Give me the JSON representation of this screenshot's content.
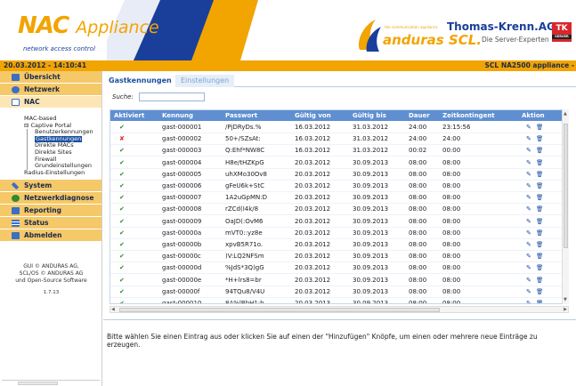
{
  "header": {
    "product_name": "NAC",
    "product_suffix": "Appliance",
    "product_tagline": "network access control",
    "partner_small": "the communication appliance",
    "partner_name": "anduras SCL.",
    "company_name": "Thomas-Krenn.AG",
    "company_tagline": "Die Server-Experten",
    "company_logo": "TK",
    "company_logo_sub": "SERVER"
  },
  "statusbar": {
    "datetime": "20.03.2012 - 14:10:41",
    "appliance": "SCL NA2500 appliance -"
  },
  "sidebar": {
    "items_top": [
      {
        "label": "Übersicht",
        "icon": "overview-icon",
        "color": "#3a6fc4"
      },
      {
        "label": "Netzwerk",
        "icon": "network-icon",
        "color": "#3a6fc4"
      },
      {
        "label": "NAC",
        "icon": "nac-icon",
        "color": "#3a6fc4"
      }
    ],
    "tree": {
      "mac_based": "MAC-based",
      "captive_portal": "Captive Portal",
      "benutzerkennungen": "Benutzerkennungen",
      "gastkennungen": "Gastkennungen",
      "direkte_macs": "Direkte MACs",
      "direkte_sites": "Direkte Sites",
      "firewall": "Firewall",
      "grundeinstellungen": "Grundeinstellungen",
      "radius": "Radius-Einstellungen"
    },
    "items_bottom": [
      {
        "label": "System",
        "icon": "wrench-icon",
        "color": "#3a6fc4"
      },
      {
        "label": "Netzwerkdiagnose",
        "icon": "diagnostics-icon",
        "color": "#2e8b2e"
      },
      {
        "label": "Reporting",
        "icon": "reporting-icon",
        "color": "#3a6fc4"
      },
      {
        "label": "Status",
        "icon": "status-icon",
        "color": "#3a6fc4"
      },
      {
        "label": "Abmelden",
        "icon": "logout-icon",
        "color": "#3a6fc4"
      }
    ],
    "footer_line1": "GUI © ANDURAS AG,",
    "footer_line2": "SCL/OS © ANDURAS AG",
    "footer_line3": "und Open-Source Software",
    "version": "1.7.13"
  },
  "tabs": {
    "active": "Gastkennungen",
    "inactive": "Einstellungen"
  },
  "search": {
    "label": "Suche:",
    "value": "",
    "placeholder": ""
  },
  "table": {
    "columns": [
      "Aktiviert",
      "Kennung",
      "Passwort",
      "Gültig von",
      "Gültig bis",
      "Dauer",
      "Zeitkontingent",
      "Aktion"
    ],
    "rows": [
      {
        "active": true,
        "id": "gast-000001",
        "pw": "/PjDRyDs.%",
        "from": "16.03.2012",
        "to": "31.03.2012",
        "dur": "24:00",
        "quota": "23:15:56"
      },
      {
        "active": false,
        "id": "gast-000002",
        "pw": "50+/SZsAt:",
        "from": "16.03.2012",
        "to": "31.03.2012",
        "dur": "24:00",
        "quota": "24:00"
      },
      {
        "active": true,
        "id": "gast-000003",
        "pw": "Q:Ehf*NW8C",
        "from": "16.03.2012",
        "to": "31.03.2012",
        "dur": "00:02",
        "quota": "00:00"
      },
      {
        "active": true,
        "id": "gast-000004",
        "pw": "H8e/tHZKpG",
        "from": "20.03.2012",
        "to": "30.09.2013",
        "dur": "08:00",
        "quota": "08:00"
      },
      {
        "active": true,
        "id": "gast-000005",
        "pw": "uhXMo30Ov8",
        "from": "20.03.2012",
        "to": "30.09.2013",
        "dur": "08:00",
        "quota": "08:00"
      },
      {
        "active": true,
        "id": "gast-000006",
        "pw": "gFeU6k+StC",
        "from": "20.03.2012",
        "to": "30.09.2013",
        "dur": "08:00",
        "quota": "08:00"
      },
      {
        "active": true,
        "id": "gast-000007",
        "pw": "1A2uGpMN:D",
        "from": "20.03.2012",
        "to": "30.09.2013",
        "dur": "08:00",
        "quota": "08:00"
      },
      {
        "active": true,
        "id": "gast-000008",
        "pw": "rZCd(I4k/8",
        "from": "20.03.2012",
        "to": "30.09.2013",
        "dur": "08:00",
        "quota": "08:00"
      },
      {
        "active": true,
        "id": "gast-000009",
        "pw": "OaJD(:OvM6",
        "from": "20.03.2012",
        "to": "30.09.2013",
        "dur": "08:00",
        "quota": "08:00"
      },
      {
        "active": true,
        "id": "gast-00000a",
        "pw": "mVT0::yz8e",
        "from": "20.03.2012",
        "to": "30.09.2013",
        "dur": "08:00",
        "quota": "08:00"
      },
      {
        "active": true,
        "id": "gast-00000b",
        "pw": "xpvB5R71o.",
        "from": "20.03.2012",
        "to": "30.09.2013",
        "dur": "08:00",
        "quota": "08:00"
      },
      {
        "active": true,
        "id": "gast-00000c",
        "pw": ")V:LQ2NFSm",
        "from": "20.03.2012",
        "to": "30.09.2013",
        "dur": "08:00",
        "quota": "08:00"
      },
      {
        "active": true,
        "id": "gast-00000d",
        "pw": "%JdS*3Q)gG",
        "from": "20.03.2012",
        "to": "30.09.2013",
        "dur": "08:00",
        "quota": "08:00"
      },
      {
        "active": true,
        "id": "gast-00000e",
        "pw": "*H+lrs8=br",
        "from": "20.03.2012",
        "to": "30.09.2013",
        "dur": "08:00",
        "quota": "08:00"
      },
      {
        "active": true,
        "id": "gast-00000f",
        "pw": "94TQu8/V4U",
        "from": "20.03.2012",
        "to": "30.09.2013",
        "dur": "08:00",
        "quota": "08:00"
      },
      {
        "active": true,
        "id": "gast-000010",
        "pw": "8A%lBbH1:b",
        "from": "20.03.2013",
        "to": "30.09.2013",
        "dur": "08:00",
        "quota": "08:00"
      }
    ]
  },
  "info_text": "Bitte wählen Sie einen Eintrag aus oder klicken Sie auf einen der \"Hinzufügen\" Knöpfe, um einen oder mehrere neue Einträge zu erzeugen.",
  "colors": {
    "accent_orange": "#f2a400",
    "brand_blue": "#1a3f9a",
    "grid_header": "#5f8fd0",
    "tk_red": "#d8262c"
  }
}
